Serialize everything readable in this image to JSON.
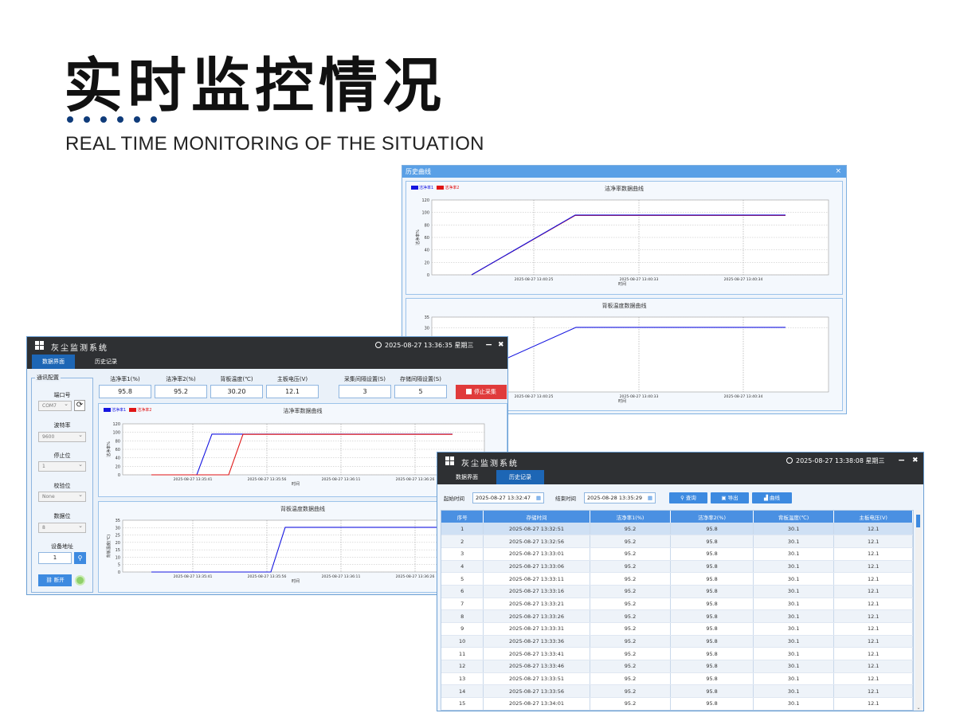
{
  "hero": {
    "title": "实时监控情况",
    "subtitle": "REAL TIME MONITORING OF THE SITUATION"
  },
  "history_window": {
    "title": "历史曲线",
    "close": "×",
    "chart_top": {
      "title": "洁净率数据曲线",
      "legend": [
        "洁净率1",
        "洁净率2"
      ],
      "ylabel": "洁净率%",
      "xlabel": "时间",
      "yticks": [
        "120",
        "100",
        "80",
        "60",
        "40",
        "20",
        "0"
      ],
      "xticks": [
        "2025-08-27 13:40:25",
        "2025-08-27 13:40:33",
        "2025-08-27 13:40:34"
      ]
    },
    "chart_bottom": {
      "title": "背板温度数据曲线",
      "yticks": [
        "35",
        "30"
      ],
      "xlabel": "时间",
      "xticks": [
        "2025-08-27 13:40:25",
        "2025-08-27 13:40:33",
        "2025-08-27 13:40:34"
      ]
    }
  },
  "main_app": {
    "app_title": "灰尘监测系统",
    "datetime": "2025-08-27   13:36:35 星期三",
    "minimize": "−",
    "close": "✖",
    "tabs": [
      "数据界面",
      "历史记录"
    ],
    "comm": {
      "group_title": "通讯配置",
      "port_label": "端口号",
      "port_value": "COM7",
      "baud_label": "波特率",
      "baud_value": "9600",
      "stop_label": "停止位",
      "stop_value": "1",
      "parity_label": "校验位",
      "parity_value": "None",
      "databits_label": "数据位",
      "databits_value": "8",
      "addr_label": "设备地址",
      "addr_value": "1",
      "disconnect_label": "断开"
    },
    "fields": [
      {
        "label": "洁净率1(%)",
        "value": "95.8"
      },
      {
        "label": "洁净率2(%)",
        "value": "95.2"
      },
      {
        "label": "背板温度(℃)",
        "value": "30.20"
      },
      {
        "label": "主板电压(V)",
        "value": "12.1"
      },
      {
        "label": "采集间隔设置(S)",
        "value": "3"
      },
      {
        "label": "存储间隔设置(S)",
        "value": "5"
      }
    ],
    "stop_button": "停止采集",
    "chart_top": {
      "title": "洁净率数据曲线",
      "legend": [
        "洁净率1",
        "洁净率2"
      ],
      "ylabel": "洁净率%",
      "xlabel": "时间",
      "yticks": [
        "120",
        "100",
        "80",
        "60",
        "40",
        "20",
        "0"
      ],
      "xticks": [
        "2025-08-27 13:35:41",
        "2025-08-27 13:35:56",
        "2025-08-27 13:36:11",
        "2025-08-27 13:36:26"
      ]
    },
    "chart_bottom": {
      "title": "背板温度数据曲线",
      "ylabel": "背板温度(℃)",
      "xlabel": "时间",
      "yticks": [
        "35",
        "30",
        "25",
        "20",
        "15",
        "10",
        "5",
        "0"
      ],
      "xticks": [
        "2025-08-27 13:35:41",
        "2025-08-27 13:35:56",
        "2025-08-27 13:36:11",
        "2025-08-27 13:36:26"
      ]
    }
  },
  "history_app": {
    "app_title": "灰尘监测系统",
    "datetime": "2025-08-27   13:38:08 星期三",
    "minimize": "−",
    "close": "✖",
    "tabs": [
      "数据界面",
      "历史记录"
    ],
    "start_label": "起始时间",
    "start_value": "2025-08-27 13:32:47",
    "end_label": "结束时间",
    "end_value": "2025-08-28 13:35:29",
    "query_label": "查询",
    "export_label": "导出",
    "curve_label": "曲线",
    "columns": [
      "序号",
      "存储时间",
      "洁净率1(%)",
      "洁净率2(%)",
      "背板温度(℃)",
      "主板电压(V)"
    ],
    "rows": [
      [
        "1",
        "2025-08-27 13:32:51",
        "95.2",
        "95.8",
        "30.1",
        "12.1"
      ],
      [
        "2",
        "2025-08-27 13:32:56",
        "95.2",
        "95.8",
        "30.1",
        "12.1"
      ],
      [
        "3",
        "2025-08-27 13:33:01",
        "95.2",
        "95.8",
        "30.1",
        "12.1"
      ],
      [
        "4",
        "2025-08-27 13:33:06",
        "95.2",
        "95.8",
        "30.1",
        "12.1"
      ],
      [
        "5",
        "2025-08-27 13:33:11",
        "95.2",
        "95.8",
        "30.1",
        "12.1"
      ],
      [
        "6",
        "2025-08-27 13:33:16",
        "95.2",
        "95.8",
        "30.1",
        "12.1"
      ],
      [
        "7",
        "2025-08-27 13:33:21",
        "95.2",
        "95.8",
        "30.1",
        "12.1"
      ],
      [
        "8",
        "2025-08-27 13:33:26",
        "95.2",
        "95.8",
        "30.1",
        "12.1"
      ],
      [
        "9",
        "2025-08-27 13:33:31",
        "95.2",
        "95.8",
        "30.1",
        "12.1"
      ],
      [
        "10",
        "2025-08-27 13:33:36",
        "95.2",
        "95.8",
        "30.1",
        "12.1"
      ],
      [
        "11",
        "2025-08-27 13:33:41",
        "95.2",
        "95.8",
        "30.1",
        "12.1"
      ],
      [
        "12",
        "2025-08-27 13:33:46",
        "95.2",
        "95.8",
        "30.1",
        "12.1"
      ],
      [
        "13",
        "2025-08-27 13:33:51",
        "95.2",
        "95.8",
        "30.1",
        "12.1"
      ],
      [
        "14",
        "2025-08-27 13:33:56",
        "95.2",
        "95.8",
        "30.1",
        "12.1"
      ],
      [
        "15",
        "2025-08-27 13:34:01",
        "95.2",
        "95.8",
        "30.1",
        "12.1"
      ]
    ]
  },
  "colors": {
    "series1": "#1515e0",
    "series2": "#e01515",
    "accent": "#1d66b5",
    "stop_button": "#e03b3b"
  }
}
